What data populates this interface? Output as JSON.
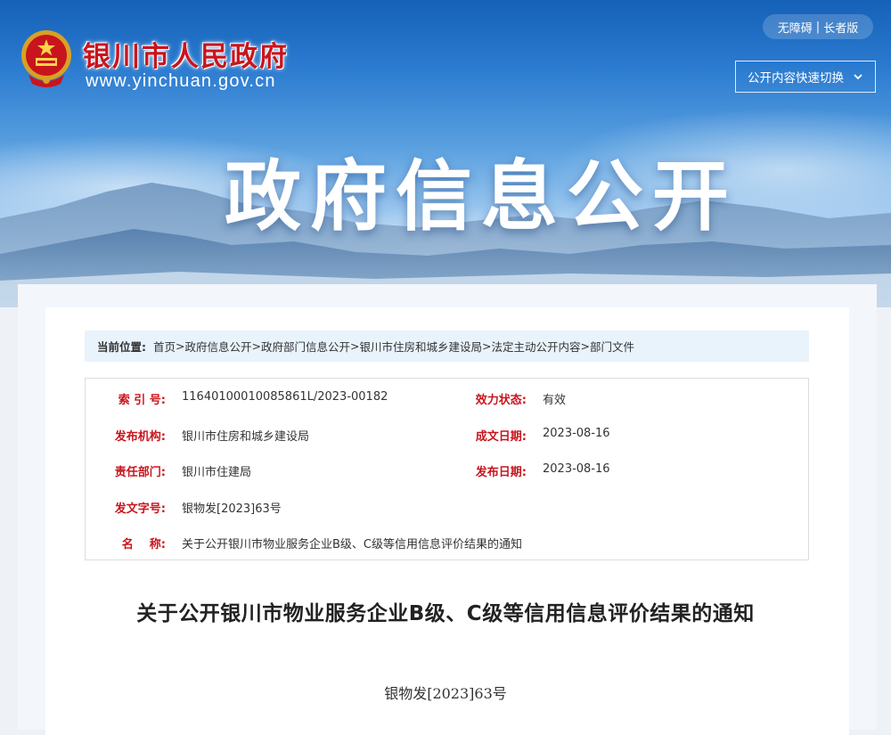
{
  "header": {
    "site_name": "银川市人民政府",
    "site_url": "www.yinchuan.gov.cn",
    "accessibility_label": "无障碍",
    "separator": "|",
    "elder_label": "长者版",
    "quick_switch_label": "公开内容快速切换",
    "banner_title": "政府信息公开"
  },
  "breadcrumb": {
    "label": "当前位置:",
    "items": [
      "首页",
      "政府信息公开",
      "政府部门信息公开",
      "银川市住房和城乡建设局",
      "法定主动公开内容",
      "部门文件"
    ],
    "separator": ">"
  },
  "meta": {
    "index_label": "索 引 号:",
    "index_value": "11640100010085861L/2023-00182",
    "status_label": "效力状态:",
    "status_value": "有效",
    "publisher_label": "发布机构:",
    "publisher_value": "银川市住房和城乡建设局",
    "created_label": "成文日期:",
    "created_value": "2023-08-16",
    "dept_label": "责任部门:",
    "dept_value": "银川市住建局",
    "published_label": "发布日期:",
    "published_value": "2023-08-16",
    "docno_label": "发文字号:",
    "docno_value": "银物发[2023]63号",
    "name_label": "名    称:",
    "name_value": "关于公开银川市物业服务企业B级、C级等信用信息评价结果的通知"
  },
  "document": {
    "title": "关于公开银川市物业服务企业B级、C级等信用信息评价结果的通知",
    "number": "银物发[2023]63号"
  },
  "colors": {
    "brand_red": "#c8151d",
    "banner_blue": "#1561b8",
    "breadcrumb_bg": "#e8f3fc"
  },
  "icons": [
    "national-emblem-icon",
    "chevron-down-icon"
  ]
}
